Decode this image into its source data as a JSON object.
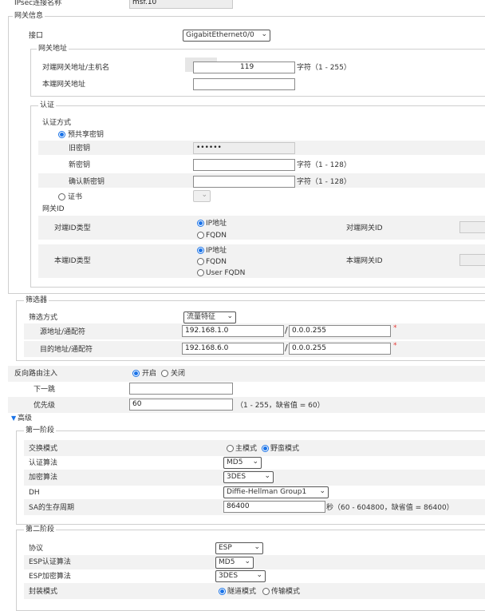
{
  "ipsec_name": {
    "label": "IPsec连接名称",
    "value": "msf.10"
  },
  "gateway_info": {
    "legend": "网关信息",
    "interface": {
      "label": "接口",
      "value": "GigabitEthernet0/0"
    },
    "gateway_address": {
      "legend": "网关地址",
      "peer": {
        "label": "对端网关地址/主机名",
        "value": "119",
        "hint": "字符（1 - 255）"
      },
      "local": {
        "label": "本端网关地址",
        "value": ""
      }
    },
    "auth": {
      "legend": "认证",
      "method_label": "认证方式",
      "psk_label": "预共享密钥",
      "old_key": {
        "label": "旧密钥",
        "value": "••••••"
      },
      "new_key": {
        "label": "新密钥",
        "value": "",
        "hint": "字符（1 - 128）"
      },
      "confirm_key": {
        "label": "确认新密钥",
        "value": "",
        "hint": "字符（1 - 128）"
      },
      "cert_label": "证书",
      "gateway_id_label": "网关ID",
      "peer_id_type": {
        "label": "对端ID类型",
        "options": [
          "IP地址",
          "FQDN"
        ],
        "selected": "IP地址"
      },
      "peer_gateway_id": {
        "label": "对端网关ID"
      },
      "local_id_type": {
        "label": "本端ID类型",
        "options": [
          "IP地址",
          "FQDN",
          "User FQDN"
        ],
        "selected": "IP地址"
      },
      "local_gateway_id": {
        "label": "本端网关ID"
      }
    }
  },
  "filter": {
    "legend": "筛选器",
    "mode": {
      "label": "筛选方式",
      "value": "流量特征"
    },
    "source": {
      "label": "源地址/通配符",
      "addr": "192.168.1.0",
      "wildcard": "0.0.0.255"
    },
    "dest": {
      "label": "目的地址/通配符",
      "addr": "192.168.6.0",
      "wildcard": "0.0.0.255"
    }
  },
  "reverse_route": {
    "label": "反向路由注入",
    "on_label": "开启",
    "off_label": "关闭",
    "selected": "开启",
    "next_hop": {
      "label": "下一跳",
      "value": ""
    },
    "priority": {
      "label": "优先级",
      "value": "60",
      "hint": "（1 - 255，缺省值 = 60）"
    }
  },
  "advanced": {
    "label": "高级",
    "phase1": {
      "legend": "第一阶段",
      "exchange_mode": {
        "label": "交换模式",
        "main": "主模式",
        "aggressive": "野蛮模式",
        "selected": "野蛮模式"
      },
      "auth_alg": {
        "label": "认证算法",
        "value": "MD5"
      },
      "enc_alg": {
        "label": "加密算法",
        "value": "3DES"
      },
      "dh": {
        "label": "DH",
        "value": "Diffie-Hellman Group1"
      },
      "sa_lifetime": {
        "label": "SA的生存周期",
        "value": "86400",
        "hint": "秒（60 - 604800，缺省值 = 86400）"
      }
    },
    "phase2": {
      "legend": "第二阶段",
      "protocol": {
        "label": "协议",
        "value": "ESP"
      },
      "esp_auth": {
        "label": "ESP认证算法",
        "value": "MD5"
      },
      "esp_enc": {
        "label": "ESP加密算法",
        "value": "3DES"
      },
      "encap_mode": {
        "label": "封装模式",
        "tunnel": "隧道模式",
        "transport": "传输模式",
        "selected": "隧道模式"
      }
    }
  }
}
